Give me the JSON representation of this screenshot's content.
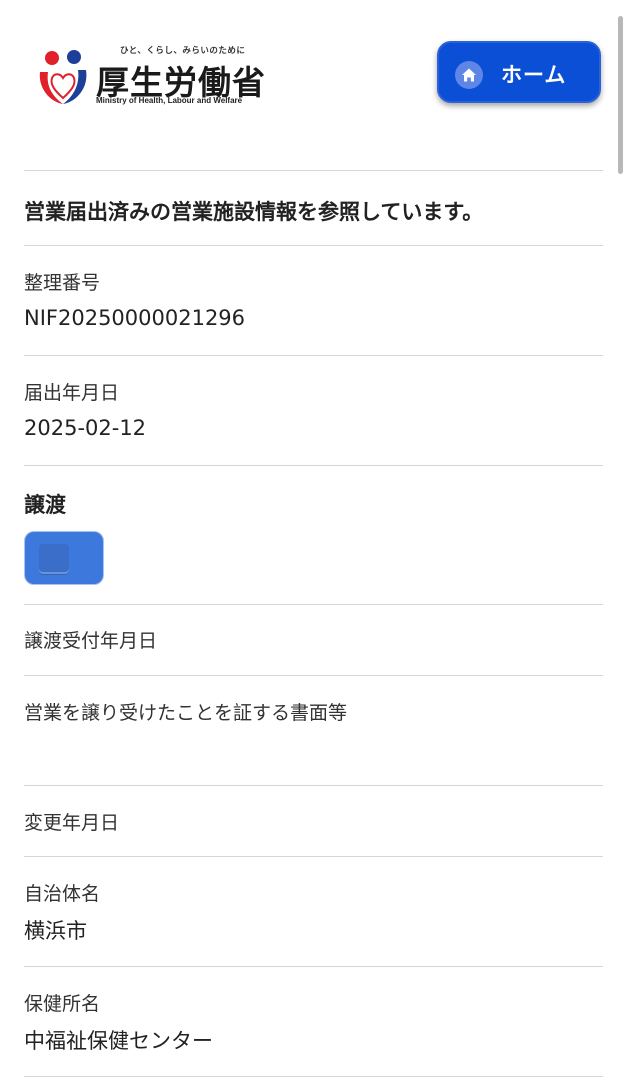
{
  "header": {
    "logo": {
      "tagline": "ひと、くらし、みらいのために",
      "name": "厚生労働省",
      "english_name": "Ministry of Health, Labour and Welfare",
      "colors": {
        "red": "#e0202a",
        "blue": "#1d3f9a"
      }
    },
    "home_button": {
      "label": "ホーム",
      "icon": "home-icon",
      "color": "#0b4fd6"
    }
  },
  "main": {
    "heading": "営業届出済みの営業施設情報を参照しています。",
    "fields": {
      "reference_number": {
        "label": "整理番号",
        "value": "NIF20250000021296"
      },
      "notification_date": {
        "label": "届出年月日",
        "value": "2025-02-12"
      },
      "transfer": {
        "label": "譲渡"
      },
      "transfer_received_date": {
        "label": "譲渡受付年月日",
        "value": ""
      },
      "transfer_documents": {
        "label": "営業を譲り受けたことを証する書面等",
        "value": ""
      },
      "change_date": {
        "label": "変更年月日",
        "value": ""
      },
      "municipality": {
        "label": "自治体名",
        "value": "横浜市"
      },
      "health_center": {
        "label": "保健所名",
        "value": "中福祉保健センター"
      }
    },
    "accent_color": "#3d78dc"
  }
}
